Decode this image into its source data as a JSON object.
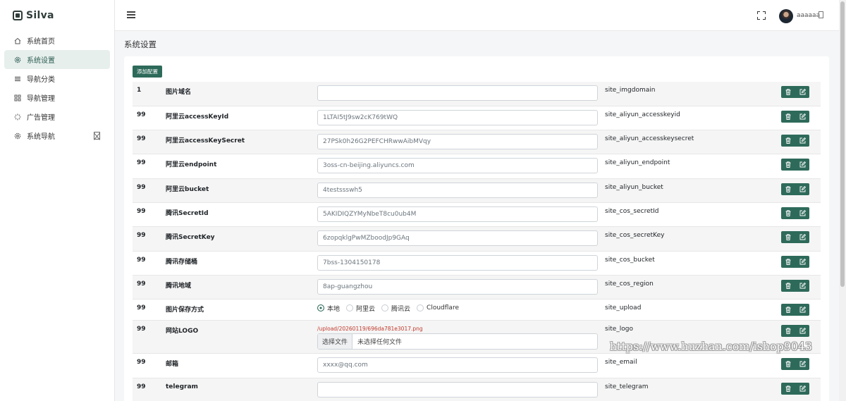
{
  "brand": {
    "name": "Silva"
  },
  "sidebar": {
    "items": [
      {
        "label": "系统首页",
        "icon": "home-icon",
        "active": false
      },
      {
        "label": "系统设置",
        "icon": "gear-icon",
        "active": true
      },
      {
        "label": "导航分类",
        "icon": "list-icon",
        "active": false
      },
      {
        "label": "导航管理",
        "icon": "grid-icon",
        "active": false
      },
      {
        "label": "广告管理",
        "icon": "loader-icon",
        "active": false
      },
      {
        "label": "系统导航",
        "icon": "gear-icon",
        "active": false
      }
    ]
  },
  "header": {
    "username": "aaaaaa"
  },
  "page": {
    "title": "系统设置",
    "add_button": "添加配置"
  },
  "rows": [
    {
      "order": "1",
      "name": "图片域名",
      "value": "",
      "key": "site_imgdomain"
    },
    {
      "order": "99",
      "name": "阿里云accessKeyId",
      "value": "1LTAI5tJ9sw2cK769tWQ",
      "key": "site_aliyun_accesskeyid"
    },
    {
      "order": "99",
      "name": "阿里云accessKeySecret",
      "value": "27PSk0h26G2PEFCHRwwAibMVqy",
      "key": "site_aliyun_accesskeysecret"
    },
    {
      "order": "99",
      "name": "阿里云endpoint",
      "value": "3oss-cn-beijing.aliyuncs.com",
      "key": "site_aliyun_endpoint"
    },
    {
      "order": "99",
      "name": "阿里云bucket",
      "value": "4testssswh5",
      "key": "site_aliyun_bucket"
    },
    {
      "order": "99",
      "name": "腾讯SecretId",
      "value": "5AKIDIQZYMyNbeT8cu0ub4M",
      "key": "site_cos_secretId"
    },
    {
      "order": "99",
      "name": "腾讯SecretKey",
      "value": "6zopqklgPwMZboodJp9GAq",
      "key": "site_cos_secretKey"
    },
    {
      "order": "99",
      "name": "腾讯存储桶",
      "value": "7bss-1304150178",
      "key": "site_cos_bucket"
    },
    {
      "order": "99",
      "name": "腾讯地域",
      "value": "8ap-guangzhou",
      "key": "site_cos_region"
    },
    {
      "order": "99",
      "name": "图片保存方式",
      "key": "site_upload",
      "options": [
        {
          "label": "本地",
          "checked": true
        },
        {
          "label": "阿里云",
          "checked": false
        },
        {
          "label": "腾讯云",
          "checked": false
        },
        {
          "label": "Cloudflare",
          "checked": false
        }
      ]
    },
    {
      "order": "99",
      "name": "网站LOGO",
      "key": "site_logo",
      "file_path": "/upload/20260119/696da781e3017.png",
      "file_button": "选择文件",
      "file_status": "未选择任何文件"
    },
    {
      "order": "99",
      "name": "邮箱",
      "value": "xxxx@qq.com",
      "key": "site_email"
    },
    {
      "order": "99",
      "name": "telegram",
      "value": "",
      "key": "site_telegram"
    }
  ],
  "watermark": "https://www.huzhan.com/ishop9043",
  "colors": {
    "primary": "#2e6a5a",
    "active_bg": "#e6efec",
    "link_red": "#c0392b"
  }
}
